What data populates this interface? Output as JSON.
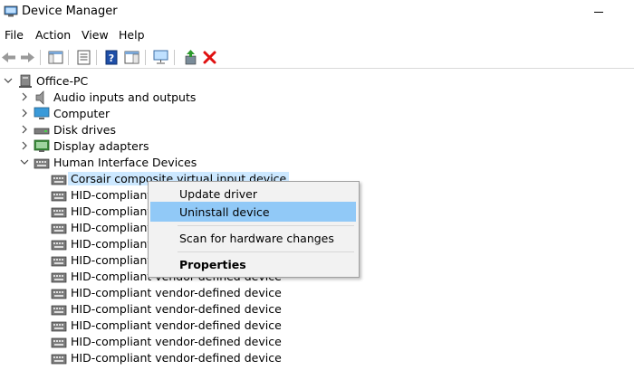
{
  "window": {
    "title": "Device Manager"
  },
  "menubar": {
    "items": [
      "File",
      "Action",
      "View",
      "Help"
    ]
  },
  "toolbar": {
    "buttons": [
      "back-icon",
      "forward-icon",
      "console-tree-icon",
      "properties-sheet-icon",
      "help-icon",
      "action-pane-icon",
      "monitor-scan-icon",
      "update-driver-icon",
      "uninstall-x-icon"
    ],
    "colors": {
      "help": "#1f4fa8",
      "uninstall": "#e01010",
      "update": "#2c9a2c"
    }
  },
  "tree": {
    "root": "Office-PC",
    "categories": [
      {
        "label": "Audio inputs and outputs",
        "expanded": false
      },
      {
        "label": "Computer",
        "expanded": false
      },
      {
        "label": "Disk drives",
        "expanded": false
      },
      {
        "label": "Display adapters",
        "expanded": false
      },
      {
        "label": "Human Interface Devices",
        "expanded": true
      }
    ],
    "hid_devices": [
      "Corsair composite virtual input device",
      "HID-compliant consumer control device",
      "HID-compliant consumer control device",
      "HID-compliant consumer control device",
      "HID-compliant system controller",
      "HID-compliant vendor-defined device",
      "HID-compliant vendor-defined device",
      "HID-compliant vendor-defined device",
      "HID-compliant vendor-defined device",
      "HID-compliant vendor-defined device",
      "HID-compliant vendor-defined device",
      "HID-compliant vendor-defined device"
    ],
    "selected_color": "#cce8ff"
  },
  "context_menu": {
    "items": [
      "Update driver",
      "Uninstall device",
      "Scan for hardware changes",
      "Properties"
    ],
    "highlighted": "Uninstall device",
    "highlight_color": "#91c9f7"
  }
}
